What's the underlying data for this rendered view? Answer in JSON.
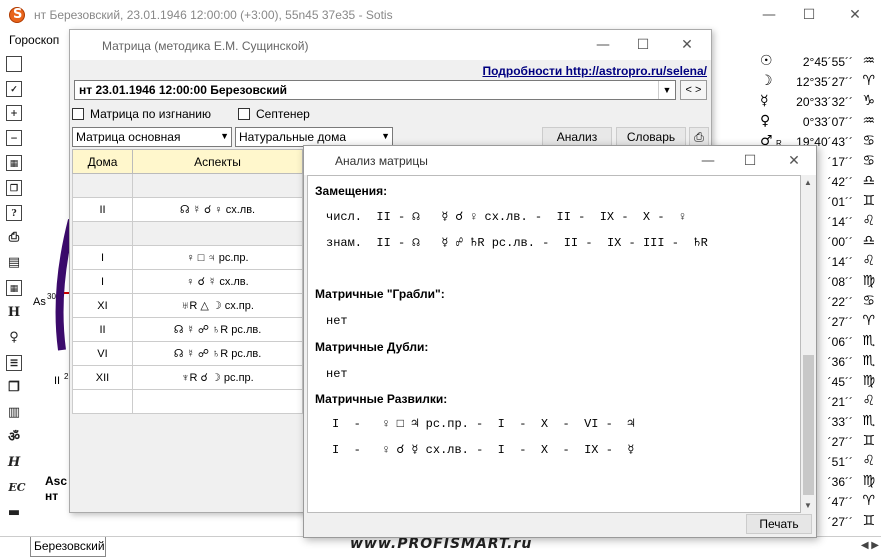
{
  "main_window": {
    "title": "нт Березовский, 23.01.1946 12:00:00 (+3:00), 55n45 37e35 - Sotis",
    "min": "—",
    "max": "☐",
    "close": "✕"
  },
  "menu": {
    "horoscope": "Гороскоп"
  },
  "toolbar_glyphs": [
    "H",
    "ॐ",
    "H",
    "EC"
  ],
  "planets": [
    {
      "glyph": "☉",
      "retro": "",
      "value": "2°45´55´´",
      "sign": "♒"
    },
    {
      "glyph": "☽",
      "retro": "",
      "value": "12°35´27´´",
      "sign": "♈"
    },
    {
      "glyph": "☿",
      "retro": "",
      "value": "20°33´32´´",
      "sign": "♑"
    },
    {
      "glyph": "♀",
      "retro": "",
      "value": "0°33´07´´",
      "sign": "♒"
    },
    {
      "glyph": "♂",
      "retro": "R",
      "value": "19°40´43´´",
      "sign": "♋"
    },
    {
      "glyph": "",
      "retro": "",
      "value": "´17´´",
      "sign": "♋"
    },
    {
      "glyph": "",
      "retro": "",
      "value": "´42´´",
      "sign": "♎"
    },
    {
      "glyph": "",
      "retro": "",
      "value": "´01´´",
      "sign": "♊"
    },
    {
      "glyph": "",
      "retro": "",
      "value": "´14´´",
      "sign": "♌"
    },
    {
      "glyph": "",
      "retro": "",
      "value": "´00´´",
      "sign": "♎"
    },
    {
      "glyph": "",
      "retro": "",
      "value": "´14´´",
      "sign": "♌"
    },
    {
      "glyph": "",
      "retro": "",
      "value": "´08´´",
      "sign": "♍"
    },
    {
      "glyph": "",
      "retro": "",
      "value": "´22´´",
      "sign": "♋"
    },
    {
      "glyph": "",
      "retro": "",
      "value": "´27´´",
      "sign": "♈"
    },
    {
      "glyph": "",
      "retro": "",
      "value": "´06´´",
      "sign": "♏"
    },
    {
      "glyph": "",
      "retro": "",
      "value": "´36´´",
      "sign": "♏"
    },
    {
      "glyph": "",
      "retro": "",
      "value": "´45´´",
      "sign": "♍"
    },
    {
      "glyph": "",
      "retro": "",
      "value": "´21´´",
      "sign": "♌"
    },
    {
      "glyph": "",
      "retro": "",
      "value": "´33´´",
      "sign": "♏"
    },
    {
      "glyph": "",
      "retro": "",
      "value": "´27´´",
      "sign": "♊"
    },
    {
      "glyph": "",
      "retro": "",
      "value": "´51´´",
      "sign": "♌"
    },
    {
      "glyph": "",
      "retro": "",
      "value": "´36´´",
      "sign": "♍"
    },
    {
      "glyph": "",
      "retro": "",
      "value": "´47´´",
      "sign": "♈"
    },
    {
      "glyph": "",
      "retro": "",
      "value": "´27´´",
      "sign": "♊"
    }
  ],
  "chart_labels": {
    "as": "As",
    "as_deg": "30",
    "ii": "II",
    "ii_deg": "2",
    "asc": "Asc",
    "nt": "нт"
  },
  "bottom_tab": "Березовский",
  "watermark": "www.PROFISMART.ru",
  "matrix_window": {
    "title": "Матрица (методика Е.М. Сущинской)",
    "link": "Подробности http://astropro.ru/selena/",
    "combo_value": "нт 23.01.1946 12:00:00 Березовский",
    "nav": "< >",
    "check_exile": "Матрица по изгнанию",
    "check_septener": "Септенер",
    "select_matrix": "Матрица основная",
    "select_houses": "Натуральные дома",
    "btn_analysis": "Анализ",
    "btn_dictionary": "Словарь",
    "col_houses": "Дома",
    "col_aspects": "Аспекты",
    "rows": [
      {
        "house": "",
        "aspect": "",
        "grey": true
      },
      {
        "house": "II",
        "aspect": "☊ ☿ ☌ ♀ сх.лв.",
        "grey": false
      },
      {
        "house": "",
        "aspect": "",
        "grey": true
      },
      {
        "house": "I",
        "aspect": "♀ □ ♃ рс.пр.",
        "grey": false
      },
      {
        "house": "I",
        "aspect": "♀ ☌ ☿ сх.лв.",
        "grey": false
      },
      {
        "house": "XI",
        "aspect": "♅R △ ☽ сх.пр.",
        "grey": false
      },
      {
        "house": "II",
        "aspect": "☊ ☿ ☍ ♄R рс.лв.",
        "grey": false
      },
      {
        "house": "VI",
        "aspect": "☊ ☿ ☍ ♄R рс.лв.",
        "grey": false
      },
      {
        "house": "XII",
        "aspect": "♆R ☌ ☽ рс.пр.",
        "grey": false
      },
      {
        "house": "",
        "aspect": "",
        "grey": false
      }
    ]
  },
  "analysis_window": {
    "title": "Анализ матрицы",
    "h_subst": "Замещения:",
    "line_chisl": "числ.  II - ☊   ☿ ☌ ♀ сх.лв. -  II -  IX -  X -  ♀",
    "line_znam": "знам.  II - ☊   ☿ ☍ ♄R рс.лв. -  II -  IX - III -  ♄R",
    "h_grabli": "Матричные \"Грабли\":",
    "grabli_val": "нет",
    "h_dubli": "Матричные Дубли:",
    "dubli_val": "нет",
    "h_razvilki": "Матричные Развилки:",
    "razv1": "I  -   ♀ □ ♃ рс.пр. -  I  -  X  -  VI -  ♃",
    "razv2": "I  -   ♀ ☌ ☿ сх.лв. -  I  -  X  -  IX -  ☿",
    "print": "Печать",
    "min": "—",
    "max": "☐",
    "close": "✕"
  }
}
